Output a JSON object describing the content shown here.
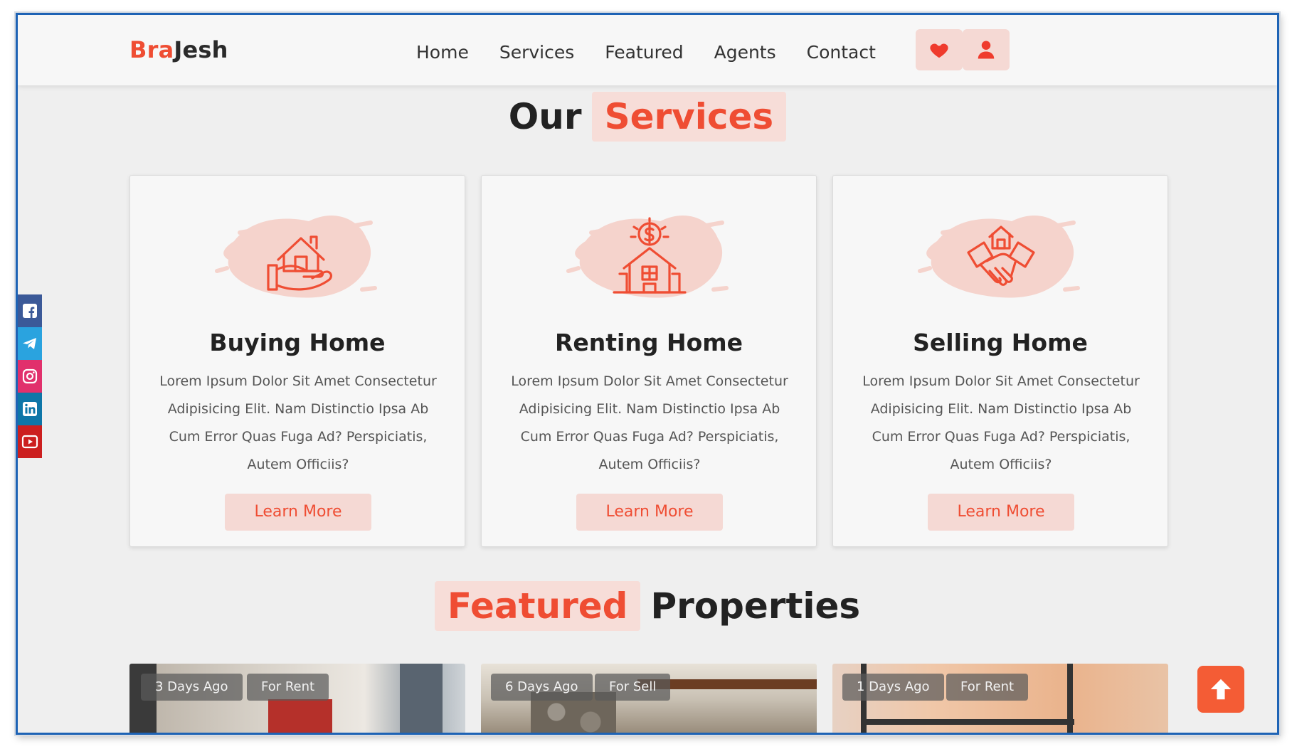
{
  "brand": {
    "part1": "Bra",
    "part2": "Jesh",
    "accent_color": "#ef4d33"
  },
  "nav": {
    "items": [
      {
        "label": "Home"
      },
      {
        "label": "Services"
      },
      {
        "label": "Featured"
      },
      {
        "label": "Agents"
      },
      {
        "label": "Contact"
      }
    ]
  },
  "header_icons": [
    "heart-icon",
    "user-icon"
  ],
  "services_section": {
    "title_plain": "Our",
    "title_highlight": "Services",
    "cards": [
      {
        "icon": "hand-holding-house-icon",
        "title": "Buying Home",
        "text": "Lorem Ipsum Dolor Sit Amet Consectetur Adipisicing Elit. Nam Distinctio Ipsa Ab Cum Error Quas Fuga Ad? Perspiciatis, Autem Officiis?",
        "button": "Learn More"
      },
      {
        "icon": "house-dollar-icon",
        "title": "Renting Home",
        "text": "Lorem Ipsum Dolor Sit Amet Consectetur Adipisicing Elit. Nam Distinctio Ipsa Ab Cum Error Quas Fuga Ad? Perspiciatis, Autem Officiis?",
        "button": "Learn More"
      },
      {
        "icon": "handshake-house-icon",
        "title": "Selling Home",
        "text": "Lorem Ipsum Dolor Sit Amet Consectetur Adipisicing Elit. Nam Distinctio Ipsa Ab Cum Error Quas Fuga Ad? Perspiciatis, Autem Officiis?",
        "button": "Learn More"
      }
    ]
  },
  "featured_section": {
    "title_highlight": "Featured",
    "title_plain": "Properties",
    "properties": [
      {
        "age": "3 Days Ago",
        "status": "For Rent"
      },
      {
        "age": "6 Days Ago",
        "status": "For Sell"
      },
      {
        "age": "1 Days Ago",
        "status": "For Rent"
      }
    ]
  },
  "social_links": [
    {
      "icon": "facebook-icon",
      "color": "#3b5998"
    },
    {
      "icon": "telegram-icon",
      "color": "#2aa3df"
    },
    {
      "icon": "instagram-icon",
      "color": "#e1306c"
    },
    {
      "icon": "linkedin-icon",
      "color": "#0e76a8"
    },
    {
      "icon": "youtube-icon",
      "color": "#cc1f1f"
    }
  ],
  "scroll_top_icon": "arrow-up-icon"
}
